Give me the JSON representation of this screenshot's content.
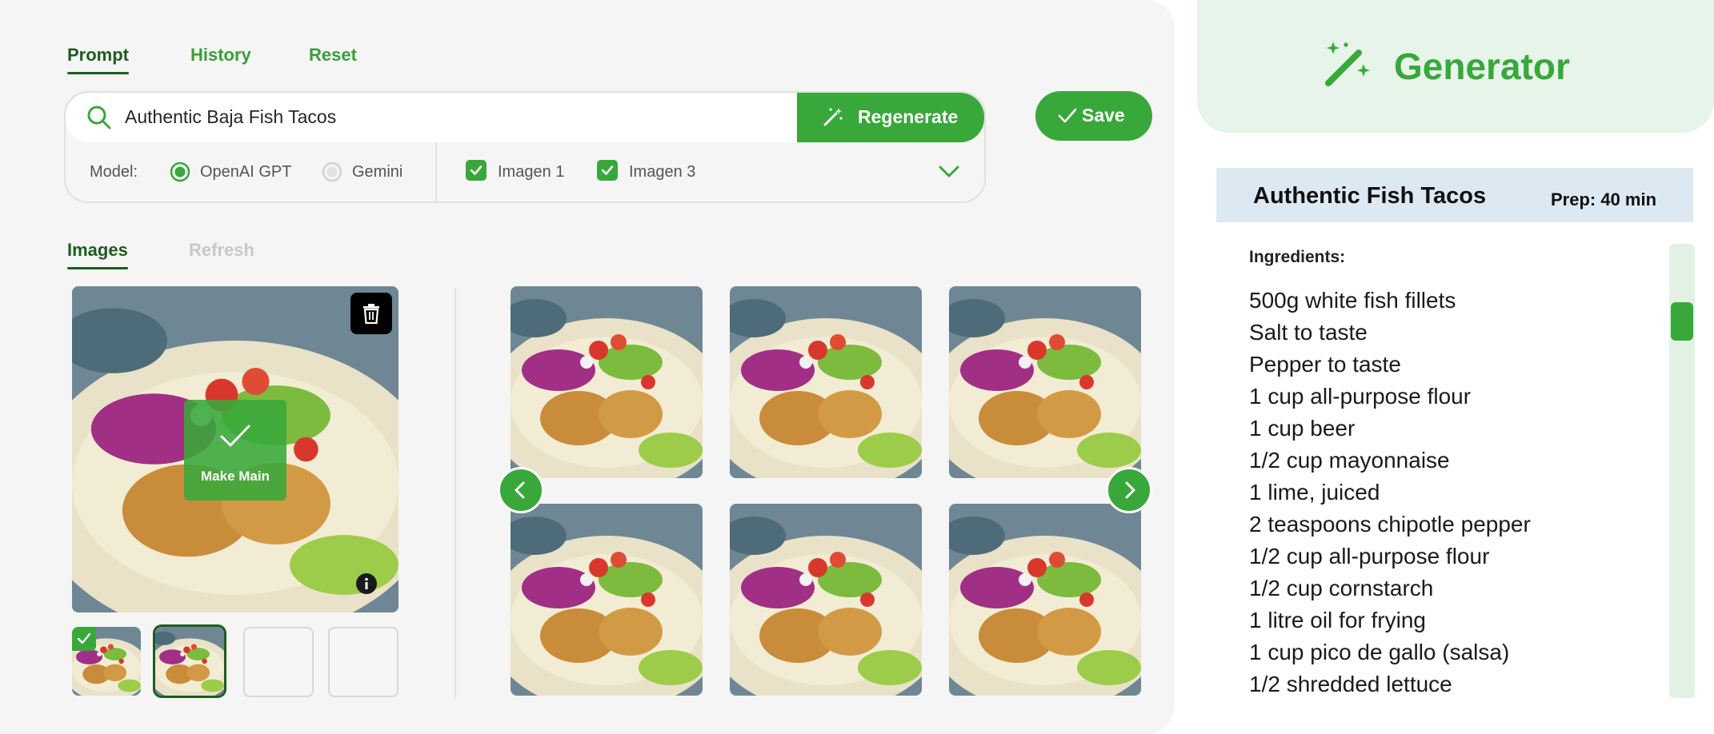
{
  "tabs": [
    {
      "label": "Prompt",
      "active": true
    },
    {
      "label": "History",
      "active": false
    },
    {
      "label": "Reset",
      "active": false
    }
  ],
  "prompt": {
    "value": "Authentic Baja Fish Tacos",
    "icon": "search-icon",
    "regenerate_label": "Regenerate"
  },
  "save_label": "Save",
  "model": {
    "label": "Model:",
    "options": [
      {
        "label": "OpenAI GPT",
        "selected": true
      },
      {
        "label": "Gemini",
        "selected": false
      }
    ],
    "image_models": [
      {
        "label": "Imagen 1",
        "checked": true
      },
      {
        "label": "Imagen 3",
        "checked": true
      }
    ]
  },
  "image_tabs": [
    {
      "label": "Images",
      "active": true
    },
    {
      "label": "Refresh",
      "active": false
    }
  ],
  "main_image": {
    "make_main_label": "Make Main"
  },
  "thumbnails": [
    "filled-main",
    "filled-selected",
    "empty",
    "empty"
  ],
  "gallery": {
    "count": 6
  },
  "generator": {
    "title": "Generator",
    "icon": "magic-wand-icon"
  },
  "recipe": {
    "title": "Authentic Fish Tacos",
    "prep": "Prep: 40 min",
    "ingredients_label": "Ingredients:",
    "ingredients": [
      "500g white fish fillets",
      "Salt to taste",
      "Pepper to taste",
      "1 cup all-purpose flour",
      "1 cup beer",
      "1/2 cup mayonnaise",
      "1 lime, juiced",
      "2 teaspoons chipotle pepper",
      "1/2 cup all-purpose flour",
      "1/2 cup cornstarch",
      "1 litre oil for frying",
      "1 cup pico de gallo (salsa)",
      "1/2 shredded lettuce"
    ]
  },
  "colors": {
    "accent": "#38a83a",
    "dark_green": "#1f5c1f",
    "panel_bg": "#f4f5f4",
    "header_bg": "#e6f4ea",
    "recipe_bar_bg": "#dde9f2"
  }
}
